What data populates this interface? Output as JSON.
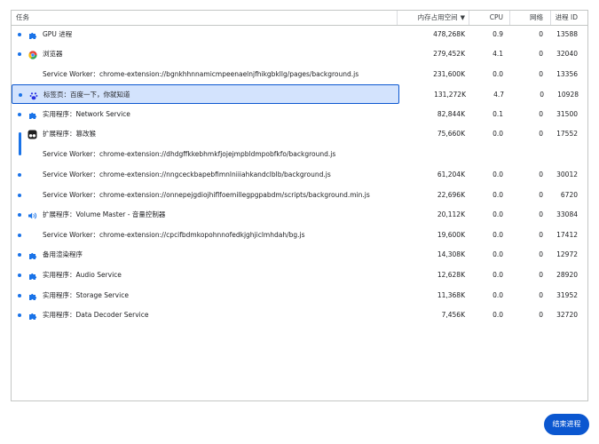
{
  "header": {
    "task": "任务",
    "memory": "内存占用空间",
    "sort_arrow": "▼",
    "cpu": "CPU",
    "network": "网络",
    "pid": "进程 ID"
  },
  "rows": [
    {
      "bullet": true,
      "icon": "puzzle-icon",
      "title": "GPU 进程",
      "memory": "478,268K",
      "cpu": "0.9",
      "network": "0",
      "pid": "13588"
    },
    {
      "bullet": true,
      "icon": "chrome-icon",
      "title": "浏览器",
      "memory": "279,452K",
      "cpu": "4.1",
      "network": "0",
      "pid": "32040"
    },
    {
      "bullet": false,
      "icon": "",
      "title": "Service Worker：chrome-extension://bgnkhhnnamicmpeenaelnjfhikgbkllg/pages/background.js",
      "memory": "231,600K",
      "cpu": "0.0",
      "network": "0",
      "pid": "13356"
    },
    {
      "bullet": true,
      "icon": "baidu-paw-icon",
      "title": "标签页：百度一下，你就知道",
      "memory": "131,272K",
      "cpu": "4.7",
      "network": "0",
      "pid": "10928",
      "selected": true
    },
    {
      "bullet": true,
      "icon": "puzzle-icon",
      "title": "实用程序：Network Service",
      "memory": "82,844K",
      "cpu": "0.1",
      "network": "0",
      "pid": "31500"
    },
    {
      "bullet": false,
      "icon": "tampermonkey-icon",
      "title": "扩展程序：篡改猴",
      "memory": "75,660K",
      "cpu": "0.0",
      "network": "0",
      "pid": "17552"
    },
    {
      "bullet": false,
      "icon": "",
      "title": "Service Worker：chrome-extension://dhdgffkkebhmkfjojejmpbldmpobfkfo/background.js",
      "memory": "",
      "cpu": "",
      "network": "",
      "pid": ""
    },
    {
      "bullet": true,
      "icon": "",
      "title": "Service Worker：chrome-extension://nngceckbapebfimnlniiiahkandclblb/background.js",
      "memory": "61,204K",
      "cpu": "0.0",
      "network": "0",
      "pid": "30012"
    },
    {
      "bullet": true,
      "icon": "",
      "title": "Service Worker：chrome-extension://onnepejgdiojhiflfoemillegpgpabdm/scripts/background.min.js",
      "memory": "22,696K",
      "cpu": "0.0",
      "network": "0",
      "pid": "6720"
    },
    {
      "bullet": true,
      "icon": "volume-icon",
      "title": "扩展程序：Volume Master - 音量控制器",
      "memory": "20,112K",
      "cpu": "0.0",
      "network": "0",
      "pid": "33084"
    },
    {
      "bullet": true,
      "icon": "",
      "title": "Service Worker：chrome-extension://cpcifbdmkopohnnofedkjghjiclmhdah/bg.js",
      "memory": "19,600K",
      "cpu": "0.0",
      "network": "0",
      "pid": "17412"
    },
    {
      "bullet": true,
      "icon": "puzzle-icon",
      "title": "备用渲染程序",
      "memory": "14,308K",
      "cpu": "0.0",
      "network": "0",
      "pid": "12972"
    },
    {
      "bullet": true,
      "icon": "puzzle-icon",
      "title": "实用程序：Audio Service",
      "memory": "12,628K",
      "cpu": "0.0",
      "network": "0",
      "pid": "28920"
    },
    {
      "bullet": true,
      "icon": "puzzle-icon",
      "title": "实用程序：Storage Service",
      "memory": "11,368K",
      "cpu": "0.0",
      "network": "0",
      "pid": "31952"
    },
    {
      "bullet": true,
      "icon": "puzzle-icon",
      "title": "实用程序：Data Decoder Service",
      "memory": "7,456K",
      "cpu": "0.0",
      "network": "0",
      "pid": "32720"
    }
  ],
  "end_process_label": "结束进程",
  "colors": {
    "accent": "#1a73e8",
    "button": "#0b57d0",
    "selection": "#d3e3fd"
  }
}
